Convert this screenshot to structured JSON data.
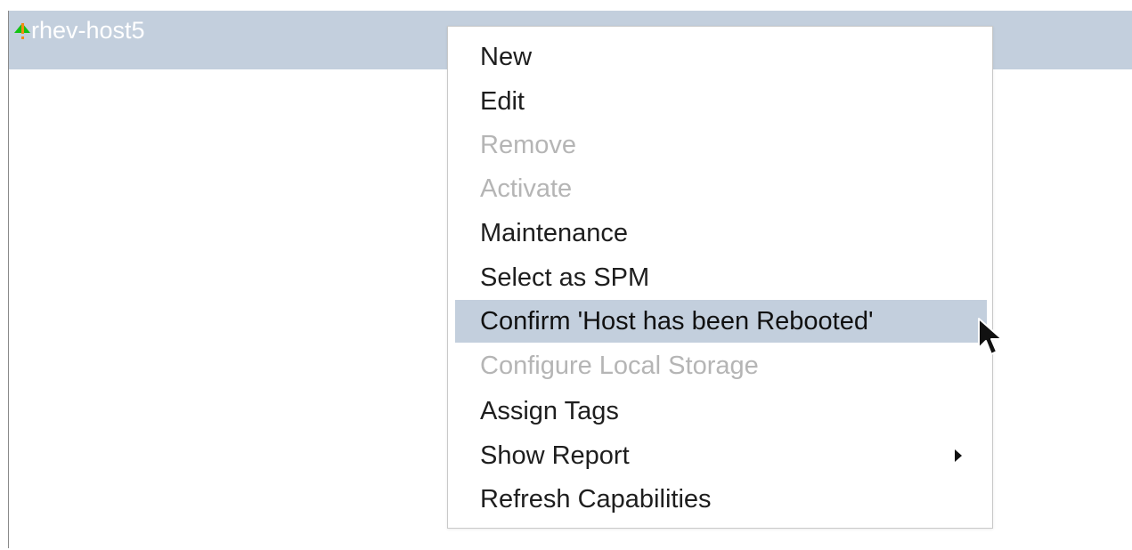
{
  "host": {
    "name": "rhev-host5",
    "status_icon": "green-up-arrow-icon",
    "alert_icon": "exclamation-alert-icon"
  },
  "context_menu": {
    "items": [
      {
        "label": "New",
        "enabled": true
      },
      {
        "label": "Edit",
        "enabled": true
      },
      {
        "label": "Remove",
        "enabled": false
      },
      {
        "label": "Activate",
        "enabled": false
      },
      {
        "label": "Maintenance",
        "enabled": true
      },
      {
        "label": "Select as SPM",
        "enabled": true
      },
      {
        "label": "Confirm 'Host has been Rebooted'",
        "enabled": true,
        "highlighted": true
      },
      {
        "label": "Configure Local Storage",
        "enabled": false
      },
      {
        "label": "Assign Tags",
        "enabled": true
      },
      {
        "label": "Show Report",
        "enabled": true,
        "has_submenu": true
      },
      {
        "label": "Refresh Capabilities",
        "enabled": true
      }
    ]
  },
  "colors": {
    "row_highlight": "#c3cfdd",
    "status_up": "#13c313",
    "alert": "#f28b13",
    "disabled_text": "#b5b5b5"
  }
}
